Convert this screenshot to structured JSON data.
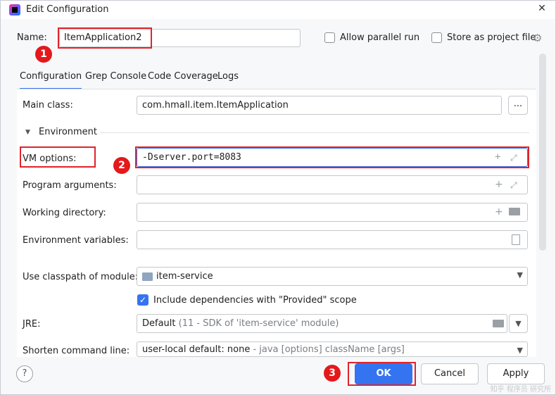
{
  "window": {
    "title": "Edit Configuration",
    "close_glyph": "✕"
  },
  "name": {
    "label": "Name:",
    "value": "ItemApplication2"
  },
  "options": {
    "allow_parallel_label": "Allow parallel run",
    "store_project_label": "Store as project file"
  },
  "tabs": [
    "Configuration",
    "Grep Console",
    "Code Coverage",
    "Logs"
  ],
  "main_class": {
    "label": "Main class:",
    "value": "com.hmall.item.ItemApplication",
    "browse_label": "..."
  },
  "environment": {
    "label": "Environment"
  },
  "vm_options": {
    "label": "VM options:",
    "value": "-Dserver.port=8083"
  },
  "program_args": {
    "label": "Program arguments:",
    "value": ""
  },
  "working_dir": {
    "label": "Working directory:",
    "value": ""
  },
  "env_vars": {
    "label": "Environment variables:",
    "value": ""
  },
  "classpath": {
    "label": "Use classpath of module:",
    "value": "item-service"
  },
  "include_deps": {
    "label": "Include dependencies with \"Provided\" scope",
    "checked": true
  },
  "jre": {
    "label": "JRE:",
    "value_main": "Default",
    "value_hint": " (11 - SDK of 'item-service' module)"
  },
  "shorten": {
    "label": "Shorten command line:",
    "value_main": "user-local default: none",
    "value_hint": " - java [options] className [args]"
  },
  "buttons": {
    "ok": "OK",
    "cancel": "Cancel",
    "apply": "Apply",
    "help": "?"
  },
  "annotations": [
    "1",
    "2",
    "3"
  ],
  "watermark": "知乎 程序员 研究所",
  "colors": {
    "accent": "#3574f0",
    "annotation_red": "#e3191c"
  }
}
